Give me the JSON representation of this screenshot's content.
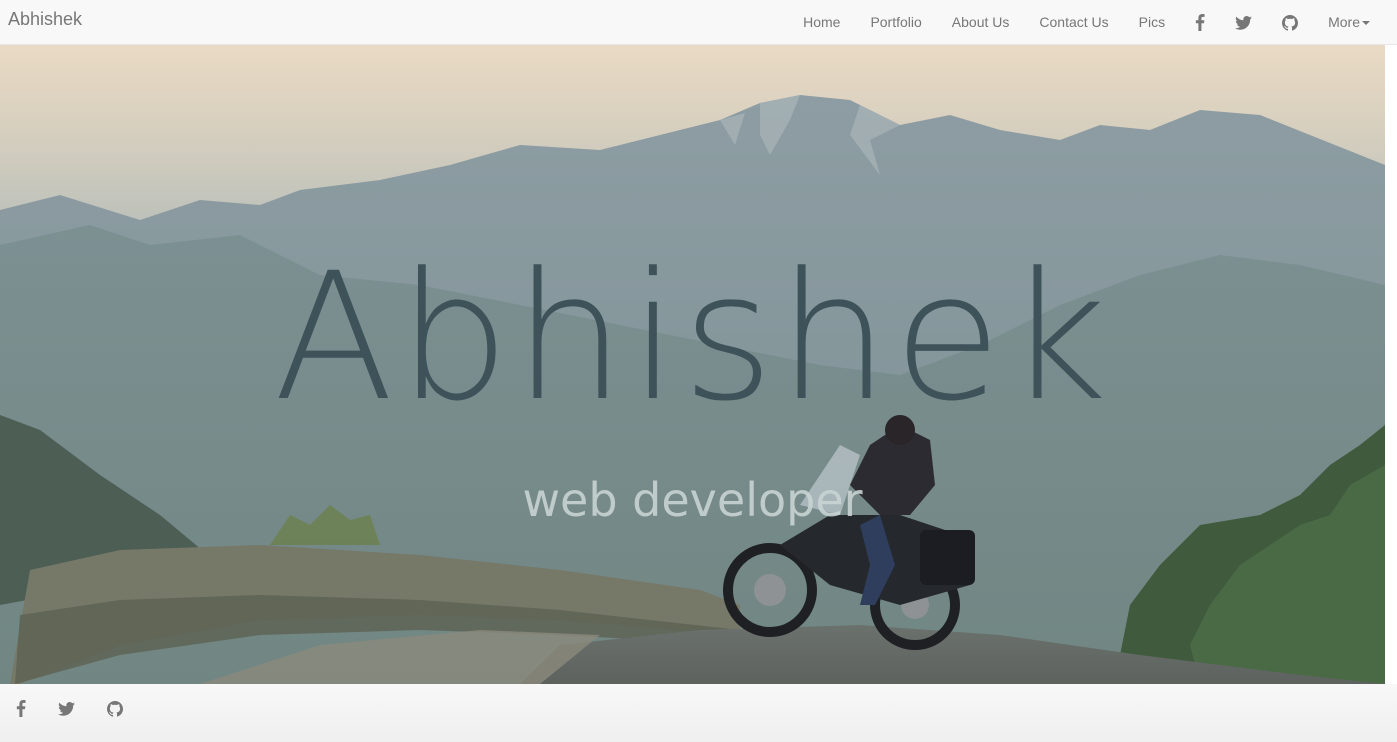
{
  "navbar": {
    "brand": "Abhishek",
    "links": [
      "Home",
      "Portfolio",
      "About Us",
      "Contact Us",
      "Pics"
    ],
    "social_icons": [
      "facebook-icon",
      "twitter-icon",
      "github-icon"
    ],
    "more_label": "More"
  },
  "hero": {
    "title": "Abhishek",
    "subtitle": "web developer"
  },
  "footer": {
    "social_icons": [
      "facebook-icon",
      "twitter-icon",
      "github-icon"
    ]
  },
  "colors": {
    "navbar_bg": "#f8f8f8",
    "nav_text": "#777777",
    "hero_title": "#3d5359",
    "hero_subtitle": "#c9d3d3"
  }
}
